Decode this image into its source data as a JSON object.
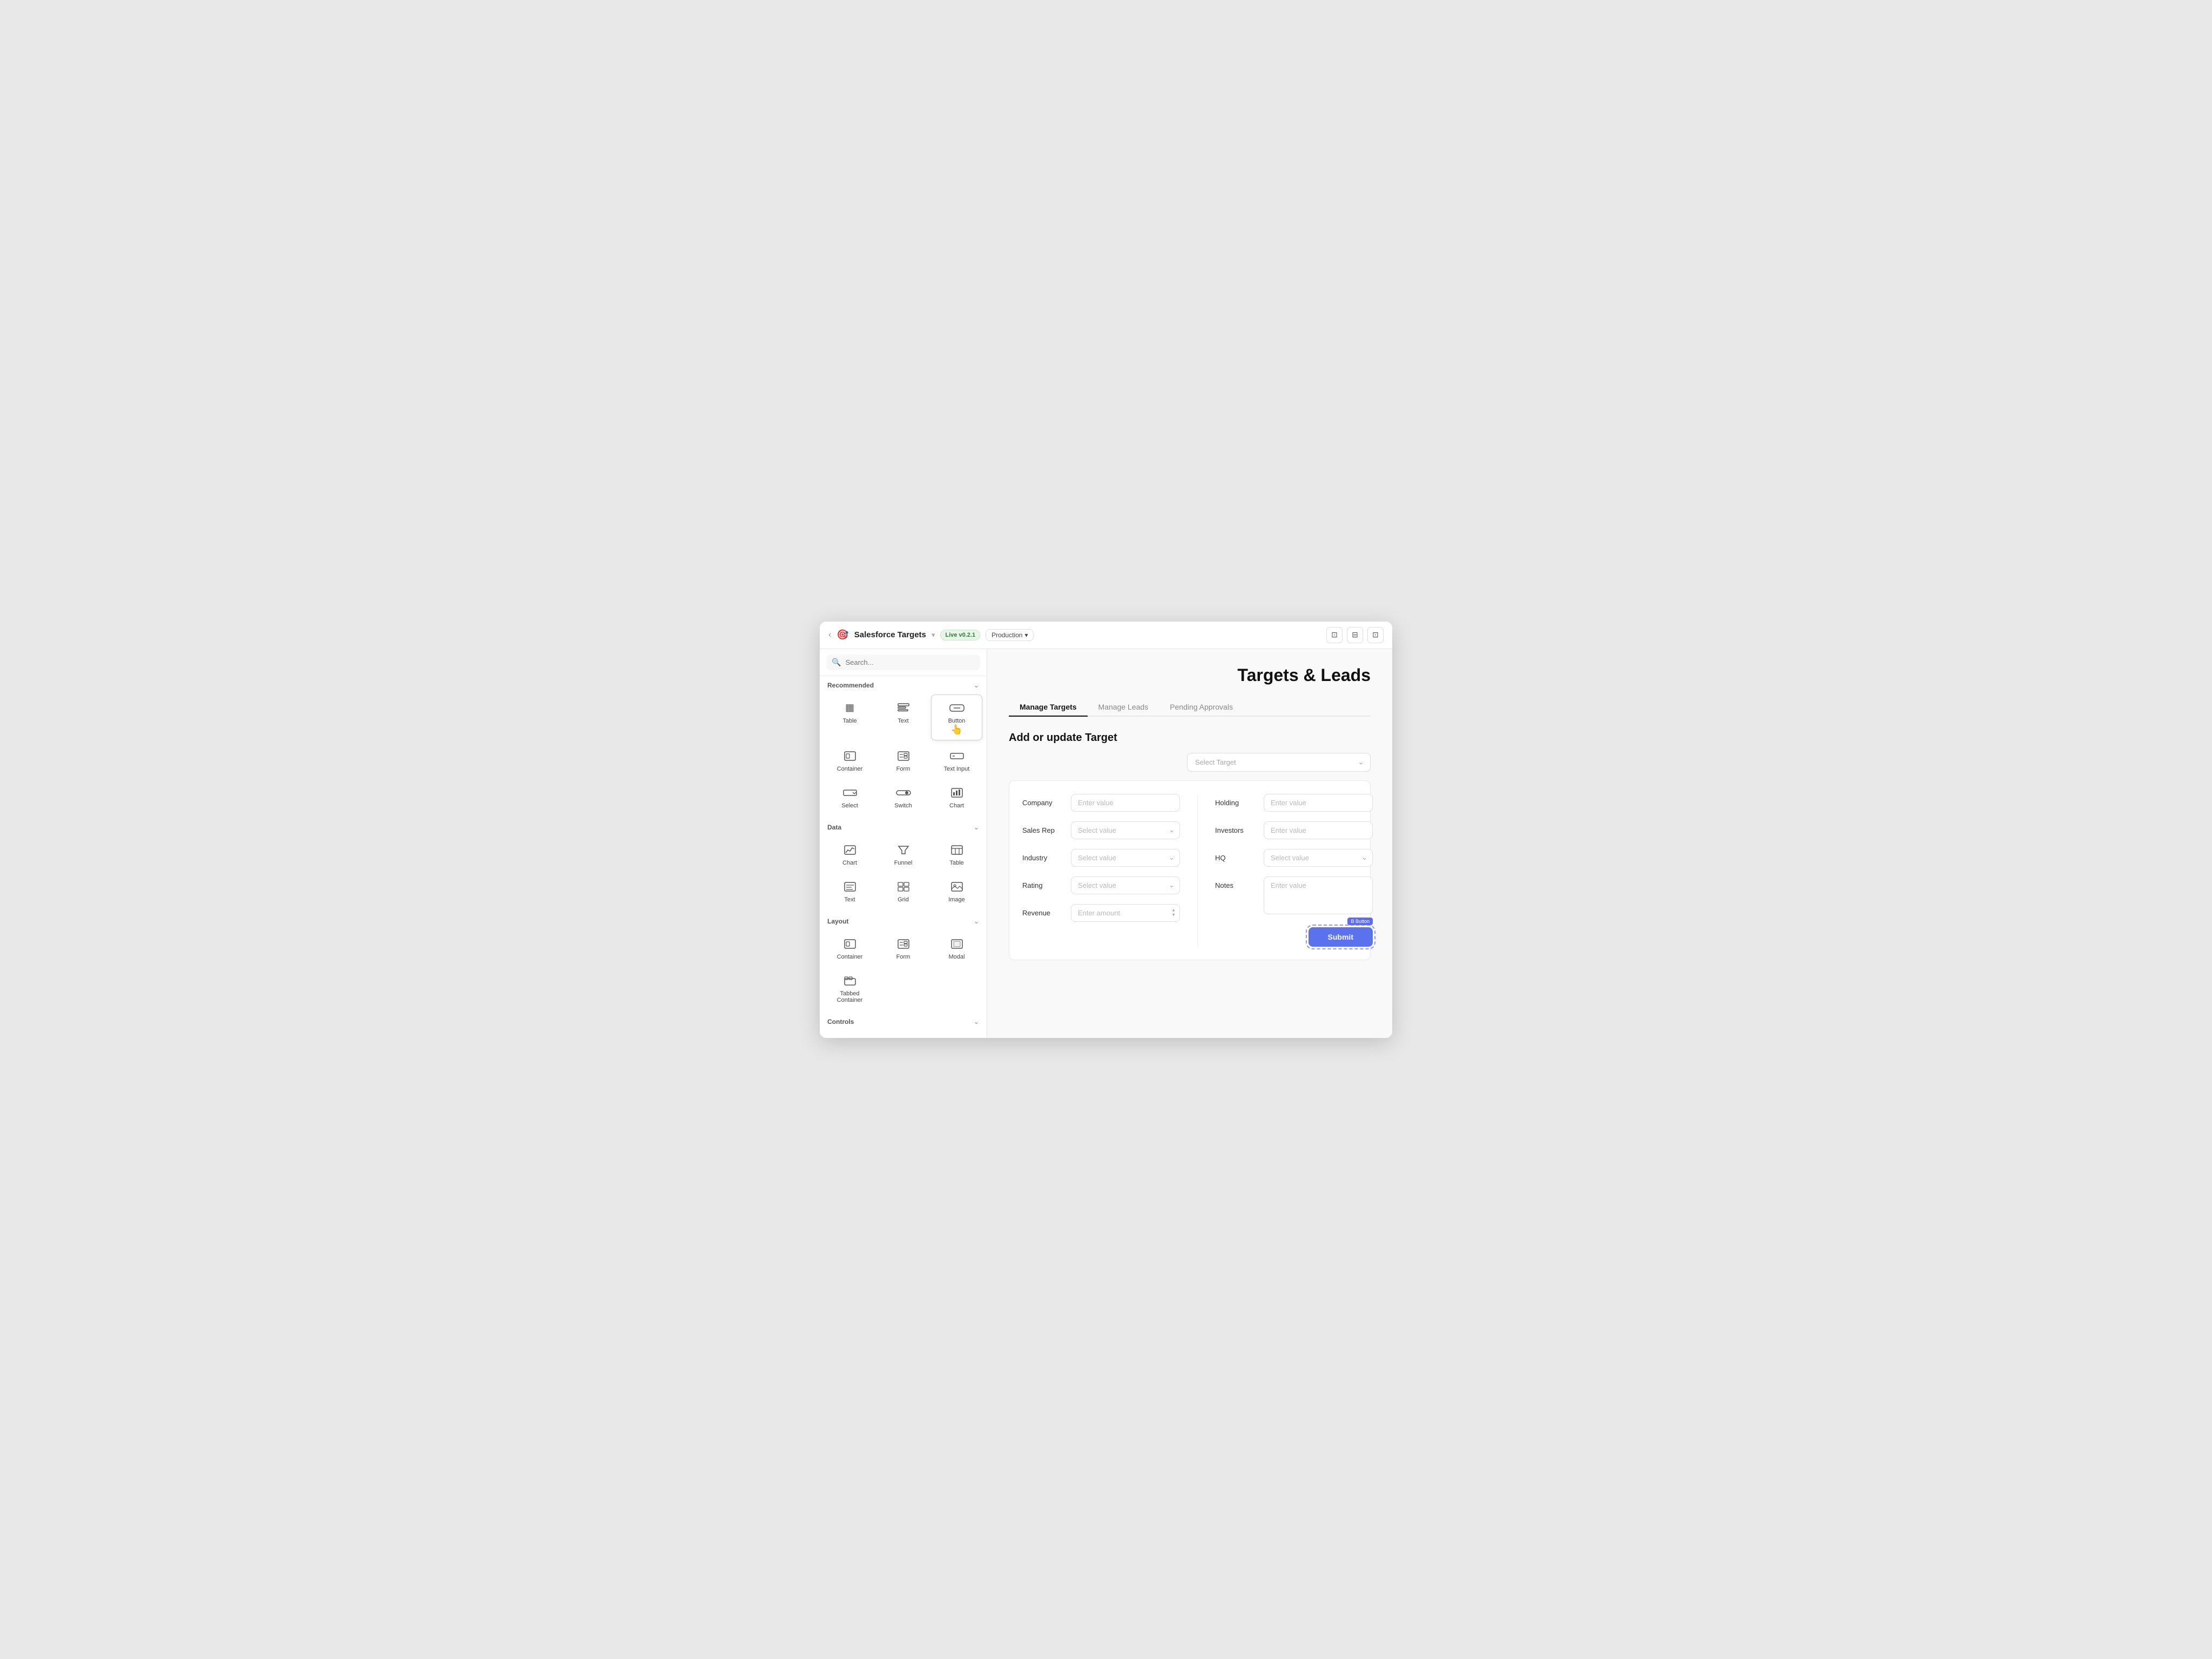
{
  "window": {
    "back_label": "‹",
    "icon": "🎯",
    "title": "Salesforce Targets",
    "dropdown_arrow": "▾",
    "badge": "Live v0.2.1",
    "environment": "Production",
    "env_arrow": "▾",
    "ctrl_btns": [
      "⊡",
      "⊟",
      "⊡"
    ]
  },
  "sidebar": {
    "search_placeholder": "Search...",
    "sections": [
      {
        "id": "recommended",
        "label": "Recommended",
        "components": [
          {
            "id": "table",
            "label": "Table",
            "icon": "▦"
          },
          {
            "id": "text",
            "label": "Text",
            "icon": "T̲"
          },
          {
            "id": "button",
            "label": "Button",
            "icon": "▭",
            "hovered": true
          },
          {
            "id": "container",
            "label": "Container",
            "icon": "⊡"
          },
          {
            "id": "form",
            "label": "Form",
            "icon": "≡"
          },
          {
            "id": "text-input",
            "label": "Text Input",
            "icon": "▱"
          },
          {
            "id": "select",
            "label": "Select",
            "icon": "⊟"
          },
          {
            "id": "switch",
            "label": "Switch",
            "icon": "⇄"
          },
          {
            "id": "chart",
            "label": "Chart",
            "icon": "⬛"
          }
        ]
      },
      {
        "id": "data",
        "label": "Data",
        "components": [
          {
            "id": "chart2",
            "label": "Chart",
            "icon": "📊"
          },
          {
            "id": "funnel",
            "label": "Funnel",
            "icon": "⊽"
          },
          {
            "id": "table2",
            "label": "Table",
            "icon": "▦"
          },
          {
            "id": "text2",
            "label": "Text",
            "icon": "T̲"
          },
          {
            "id": "grid",
            "label": "Grid",
            "icon": "⊞"
          },
          {
            "id": "image",
            "label": "Image",
            "icon": "⬚"
          }
        ]
      },
      {
        "id": "layout",
        "label": "Layout",
        "components": [
          {
            "id": "container2",
            "label": "Container",
            "icon": "⊡"
          },
          {
            "id": "form2",
            "label": "Form",
            "icon": "≡"
          },
          {
            "id": "modal",
            "label": "Modal",
            "icon": "▭"
          },
          {
            "id": "tabbed-container",
            "label": "Tabbed Container",
            "icon": "⊡"
          }
        ]
      },
      {
        "id": "controls",
        "label": "Controls",
        "components": [
          {
            "id": "ctrl1",
            "label": "",
            "icon": "⊟"
          },
          {
            "id": "ctrl2",
            "label": "",
            "icon": "⊟"
          }
        ]
      }
    ]
  },
  "content": {
    "page_title": "Targets & Leads",
    "tabs": [
      {
        "id": "manage-targets",
        "label": "Manage Targets",
        "active": true
      },
      {
        "id": "manage-leads",
        "label": "Manage Leads",
        "active": false
      },
      {
        "id": "pending-approvals",
        "label": "Pending Approvals",
        "active": false
      }
    ],
    "form_section_title": "Add or update Target",
    "select_target_placeholder": "Select Target",
    "form": {
      "left_fields": [
        {
          "id": "company",
          "label": "Company",
          "type": "input",
          "placeholder": "Enter value"
        },
        {
          "id": "sales-rep",
          "label": "Sales Rep",
          "type": "select",
          "placeholder": "Select value"
        },
        {
          "id": "industry",
          "label": "Industry",
          "type": "select",
          "placeholder": "Select value"
        },
        {
          "id": "rating",
          "label": "Rating",
          "type": "select",
          "placeholder": "Select value"
        },
        {
          "id": "revenue",
          "label": "Revenue",
          "type": "stepper",
          "placeholder": "Enter amount"
        }
      ],
      "right_fields": [
        {
          "id": "holding",
          "label": "Holding",
          "type": "input",
          "placeholder": "Enter value"
        },
        {
          "id": "investors",
          "label": "Investors",
          "type": "input",
          "placeholder": "Enter value"
        },
        {
          "id": "hq",
          "label": "HQ",
          "type": "select",
          "placeholder": "Select value"
        },
        {
          "id": "notes",
          "label": "Notes",
          "type": "textarea",
          "placeholder": "Enter value"
        }
      ]
    },
    "submit_btn_label": "B Button",
    "submit_btn_text": "Submit"
  }
}
